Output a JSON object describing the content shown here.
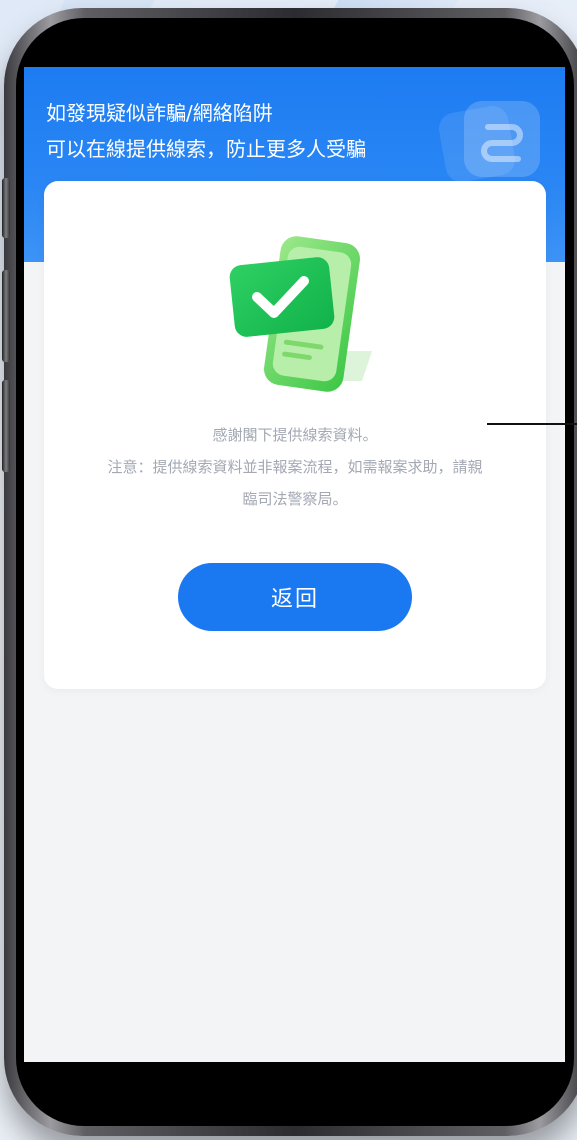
{
  "header": {
    "line1": "如發現疑似詐騙/網絡陷阱",
    "line2": "可以在線提供線索，防止更多人受騙"
  },
  "card": {
    "thanks": "感謝閣下提供線索資料。",
    "notice_line1": "注意：提供線索資料並非報案流程，如需報案求助，請親",
    "notice_line2": "臨司法警察局。",
    "back_label": "返回"
  },
  "icons": {
    "success": "success-check-icon",
    "app_logo": "app-logo-icon"
  },
  "colors": {
    "primary": "#1a78f0",
    "success": "#3ccf4e",
    "muted_text": "#a3a8b3"
  }
}
